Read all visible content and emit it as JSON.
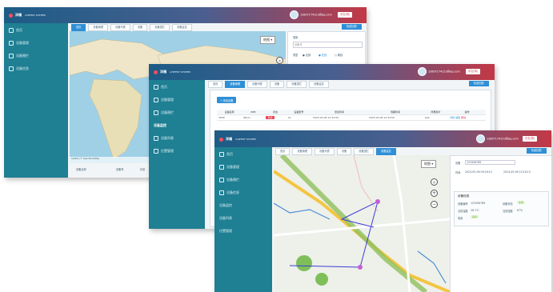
{
  "app": {
    "logo_text": "洋福",
    "logo_sub": "LYSFEST SYSTEM",
    "user_account": "13807174123@qq.com",
    "language": "中文(简)"
  },
  "sidebar": {
    "items": [
      {
        "label": "首页",
        "icon": "home-icon"
      },
      {
        "label": "设备管理",
        "icon": "device-icon"
      },
      {
        "label": "设备围栏",
        "icon": "fence-icon"
      },
      {
        "label": "设备信息",
        "icon": "info-icon"
      },
      {
        "label": "设备监控",
        "icon": "monitor-icon"
      },
      {
        "label": "设备列表",
        "icon": "list-icon"
      },
      {
        "label": "位置管理",
        "icon": "location-icon"
      }
    ]
  },
  "tabs": [
    "首页",
    "设备管理",
    "设备列表",
    "设备",
    "设备围栏",
    "设备监控"
  ],
  "right_tab": "轨迹回放",
  "win1": {
    "map_type": "地图",
    "search_label": "搜索",
    "search_placeholder": "设备号",
    "filter_label": "类型",
    "filter_all": "全部",
    "filter_online": "在线",
    "filter_offline": "离线",
    "bottom_labels": [
      "设备名称",
      "设备号",
      "状态"
    ],
    "map_attribution": "Leaflet | © OpenStreetMap"
  },
  "win2": {
    "add_button": "+ 添加设备",
    "columns": [
      "设备名称",
      "IMEI",
      "状态",
      "设备型号",
      "激活时间",
      "到期时间",
      "所属用户",
      "操作"
    ],
    "rows": [
      {
        "name": "3658",
        "imei": "8612...",
        "status": "离线",
        "model": "A1",
        "activated": "2023-03-06 12:34:56",
        "expire": "2025-03-06 12:34:56",
        "user": "test",
        "ops": [
          "详情",
          "编辑",
          "删除"
        ]
      }
    ]
  },
  "win3": {
    "map_type": "地图",
    "device_label": "设备",
    "device_value": "123456789",
    "time_label": "时间",
    "time_from": "2024-05-06 09:16:15",
    "time_to": "2024-05-06 10:16:15",
    "info_title": "设备信息",
    "info": {
      "device_no_label": "设备编号",
      "device_no": "123456789",
      "status_label": "设备状态",
      "status": "在线",
      "temp_label": "当前温度",
      "temp": "26.7℃",
      "humidity_label": "当前湿度",
      "humidity": "67%",
      "battery_label": "电量",
      "battery": "良好"
    }
  },
  "colors": {
    "topbar_left": "#1c5c86",
    "topbar_right": "#c33846",
    "sidebar": "#1f7f93",
    "accent": "#2f8fd6"
  }
}
